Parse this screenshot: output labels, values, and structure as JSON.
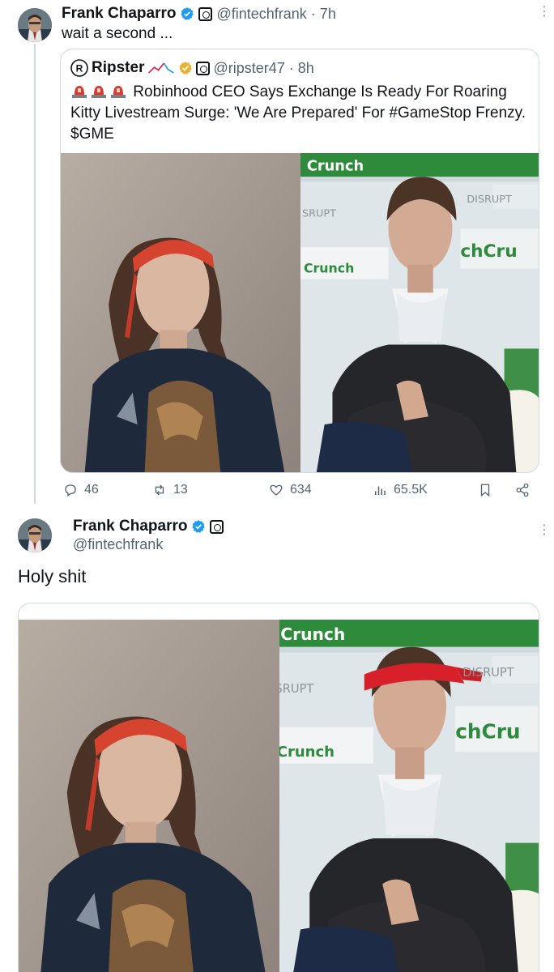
{
  "tweet1": {
    "author_name": "Frank Chaparro",
    "handle_time": "@fintechfrank · 7h",
    "text": "wait a second ...",
    "quote": {
      "author_name": "Ripster",
      "handle_time": "@ripster47 · 8h",
      "text": "Robinhood CEO Says Exchange Is Ready For Roaring Kitty Livestream Surge: 'We Are Prepared' For #GameStop Frenzy. $GME"
    },
    "actions": {
      "replies": "46",
      "retweets": "13",
      "likes": "634",
      "views": "65.5K"
    }
  },
  "tweet2": {
    "author_name": "Frank Chaparro",
    "handle": "@fintechfrank",
    "text": "Holy shit"
  },
  "photo_text": {
    "sign_top": "Crunch",
    "sign_mid": "Crunch",
    "sign_right": "chCru",
    "sign_rupt": "DISRUPT",
    "sign_rupt2": "SRUPT"
  },
  "colors": {
    "accent": "#1d9bf0",
    "gold": "#e8b339",
    "headband": "#d83a2e",
    "text_secondary": "#536471",
    "border": "#cfd9de"
  },
  "icons": {
    "verified": "verified-badge-icon",
    "affiliate": "affiliate-badge-icon",
    "reply": "reply-icon",
    "retweet": "retweet-icon",
    "like": "heart-icon",
    "views": "views-icon",
    "bookmark": "bookmark-icon",
    "share": "share-icon",
    "more": "more-icon",
    "siren": "siren-icon"
  }
}
